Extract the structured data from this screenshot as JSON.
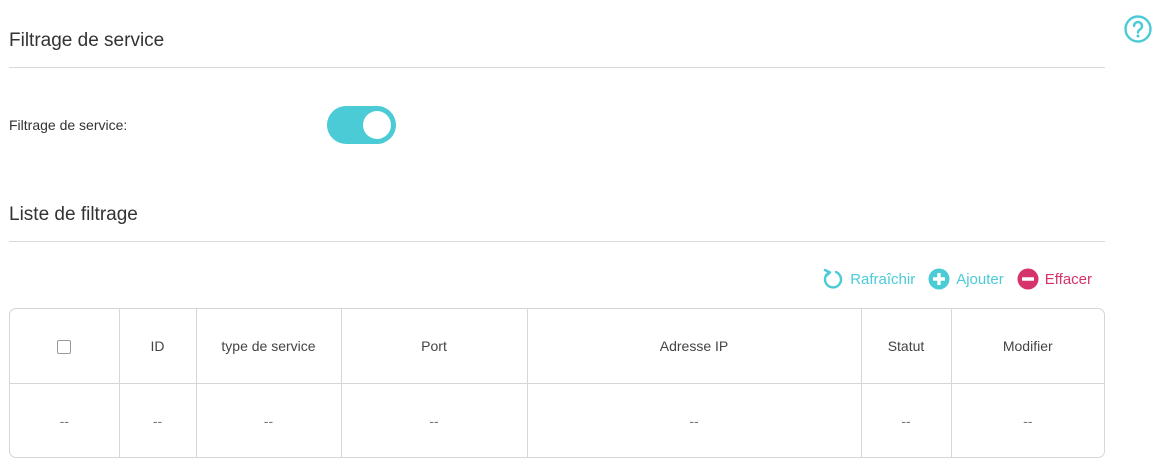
{
  "service_filter": {
    "section_title": "Filtrage de service",
    "toggle_label": "Filtrage de service:",
    "toggle_on": true
  },
  "filter_list": {
    "section_title": "Liste de filtrage",
    "toolbar": {
      "refresh_label": "Rafraîchir",
      "add_label": "Ajouter",
      "delete_label": "Effacer"
    },
    "columns": [
      "ID",
      "type de service",
      "Port",
      "Adresse IP",
      "Statut",
      "Modifier"
    ],
    "rows": [
      [
        "--",
        "--",
        "--",
        "--",
        "--",
        "--",
        "--"
      ]
    ]
  },
  "colors": {
    "accent": "#4acbd6",
    "danger": "#d6336c"
  }
}
